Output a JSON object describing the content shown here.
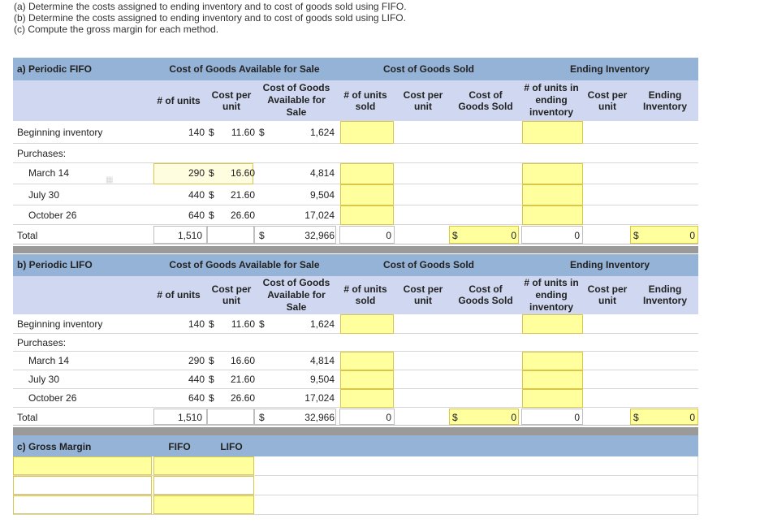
{
  "instructions": [
    "(a) Determine the costs assigned to ending inventory and to cost of goods sold using FIFO.",
    "(b) Determine the costs assigned to ending inventory and to cost of goods sold using LIFO.",
    "(c) Compute the gross margin for each method."
  ],
  "sections": {
    "a_title": "a) Periodic FIFO",
    "b_title": "b) Periodic LIFO",
    "c_title": "c) Gross Margin"
  },
  "groups": {
    "cogas": "Cost of Goods Available for Sale",
    "cogs": "Cost of Goods Sold",
    "ending": "Ending Inventory"
  },
  "col_headers": {
    "units": "# of units",
    "cost_per_unit": "Cost per unit",
    "cogas_total": "Cost of Goods Available for Sale",
    "units_sold": "# of units sold",
    "cost_per_unit_sold": "Cost per unit",
    "cogs_total": "Cost of Goods Sold",
    "units_ending": "# of units in ending inventory",
    "cost_per_unit_end": "Cost per unit",
    "ending_total": "Ending Inventory"
  },
  "rows": {
    "beginning": "Beginning inventory",
    "purchases": "Purchases:",
    "march": "March 14",
    "july": "July 30",
    "october": "October 26",
    "total": "Total"
  },
  "data": {
    "beg_units": "140",
    "beg_cost": "11.60",
    "beg_total": "1,624",
    "mar_units": "290",
    "mar_cost": "16.60",
    "mar_total": "4,814",
    "jul_units": "440",
    "jul_cost": "21.60",
    "jul_total": "9,504",
    "oct_units": "640",
    "oct_cost": "26.60",
    "oct_total": "17,024",
    "tot_units": "1,510",
    "tot_total": "32,966",
    "units_sold_total": "0",
    "cogs_total": "0",
    "units_end_total": "0",
    "ending_total": "0"
  },
  "currency": "$",
  "gross_margin_cols": {
    "fifo": "FIFO",
    "lifo": "LIFO"
  },
  "colors": {
    "header": "#95b3d7",
    "subheader": "#cfd8f0",
    "separator": "#9a9a9a",
    "input_border": "#dcc64a",
    "highlight": "#ffff9d"
  }
}
